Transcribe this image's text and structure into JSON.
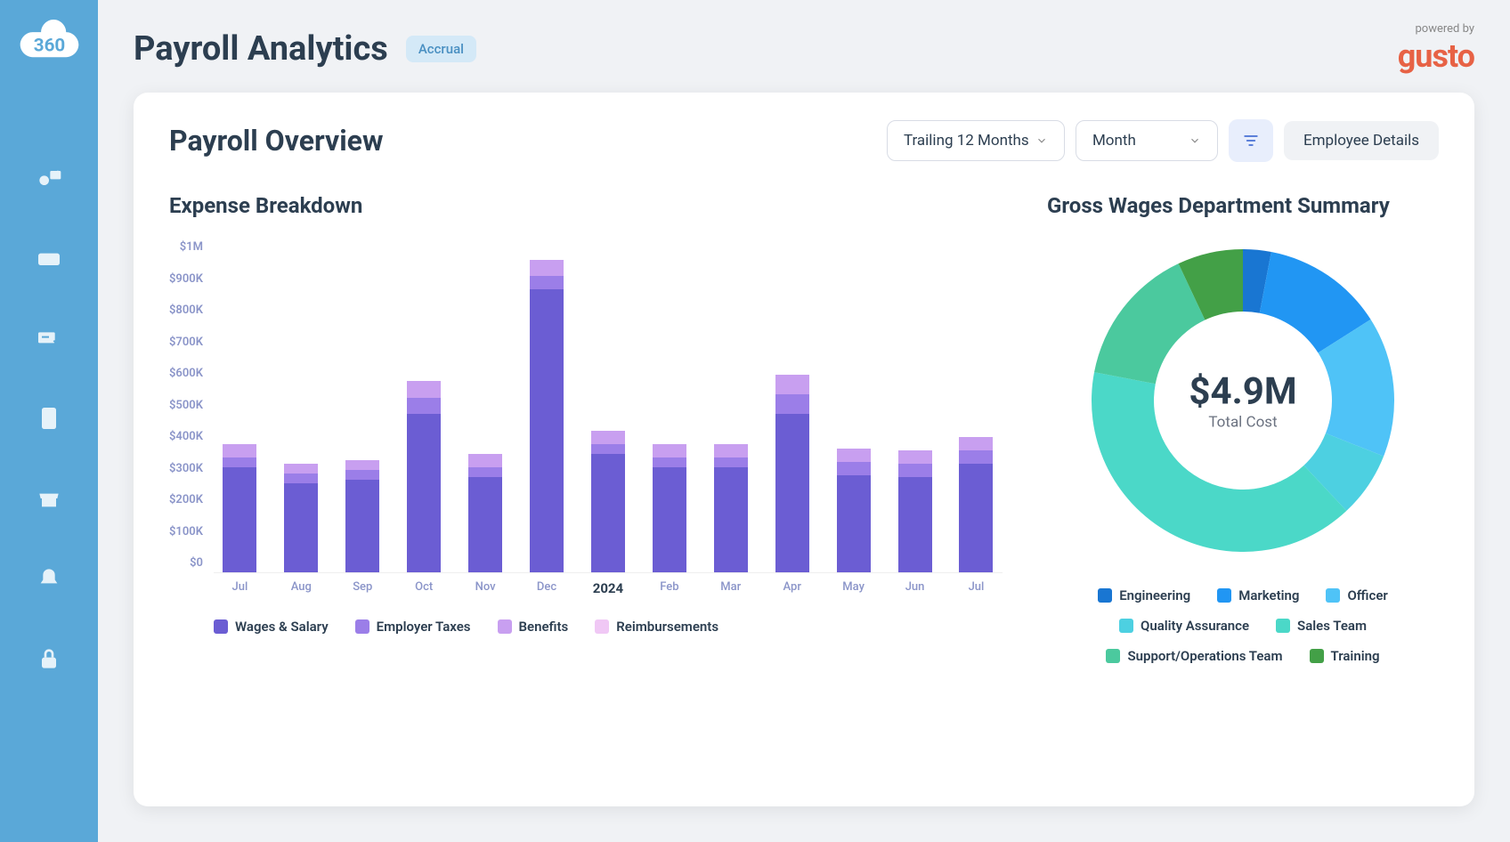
{
  "header": {
    "title": "Payroll Analytics",
    "badge": "Accrual",
    "powered_by": "powered by",
    "brand": "gusto"
  },
  "overview": {
    "title": "Payroll Overview",
    "period_select": "Trailing 12 Months",
    "granularity_select": "Month",
    "employee_details_label": "Employee Details"
  },
  "expense_chart": {
    "title": "Expense Breakdown",
    "legend": {
      "wages": "Wages & Salary",
      "taxes": "Employer Taxes",
      "benefits": "Benefits",
      "reimb": "Reimbursements"
    }
  },
  "donut": {
    "title": "Gross Wages Department Summary",
    "center_value": "$4.9M",
    "center_label": "Total Cost",
    "legend": {
      "engineering": "Engineering",
      "marketing": "Marketing",
      "officer": "Officer",
      "qa": "Quality Assurance",
      "sales": "Sales Team",
      "support": "Support/Operations Team",
      "training": "Training"
    }
  },
  "colors": {
    "wages": "#6b5dd3",
    "taxes": "#9b7ee8",
    "benefits": "#c89ff0",
    "reimb": "#f0c8f5",
    "engineering": "#1976d2",
    "marketing": "#2196f3",
    "officer": "#4fc3f7",
    "qa": "#4dd0e1",
    "sales": "#4bd8c8",
    "support": "#4bc99e",
    "training": "#43a047"
  },
  "chart_data": [
    {
      "type": "bar",
      "title": "Expense Breakdown",
      "ylabel": "",
      "xlabel": "",
      "ylim": [
        0,
        1000000
      ],
      "y_ticks": [
        "$1M",
        "$900K",
        "$800K",
        "$700K",
        "$600K",
        "$500K",
        "$400K",
        "$300K",
        "$200K",
        "$100K",
        "$0"
      ],
      "categories": [
        "Jul",
        "Aug",
        "Sep",
        "Oct",
        "Nov",
        "Dec",
        "2024",
        "Feb",
        "Mar",
        "Apr",
        "May",
        "Jun",
        "Jul"
      ],
      "series": [
        {
          "name": "Wages & Salary",
          "values": [
            320000,
            270000,
            280000,
            480000,
            290000,
            860000,
            360000,
            320000,
            320000,
            480000,
            295000,
            290000,
            330000
          ]
        },
        {
          "name": "Employer Taxes",
          "values": [
            30000,
            30000,
            30000,
            50000,
            30000,
            40000,
            30000,
            30000,
            30000,
            60000,
            40000,
            40000,
            40000
          ]
        },
        {
          "name": "Benefits",
          "values": [
            40000,
            30000,
            30000,
            50000,
            40000,
            50000,
            40000,
            40000,
            40000,
            60000,
            40000,
            40000,
            40000
          ]
        },
        {
          "name": "Reimbursements",
          "values": [
            0,
            0,
            0,
            0,
            0,
            0,
            0,
            0,
            0,
            0,
            0,
            0,
            0
          ]
        }
      ]
    },
    {
      "type": "pie",
      "title": "Gross Wages Department Summary",
      "center_value": "$4.9M",
      "center_label": "Total Cost",
      "series": [
        {
          "name": "Engineering",
          "value": 3,
          "color": "#1976d2"
        },
        {
          "name": "Marketing",
          "value": 13,
          "color": "#2196f3"
        },
        {
          "name": "Officer",
          "value": 15,
          "color": "#4fc3f7"
        },
        {
          "name": "Quality Assurance",
          "value": 7,
          "color": "#4dd0e1"
        },
        {
          "name": "Sales Team",
          "value": 40,
          "color": "#4bd8c8"
        },
        {
          "name": "Support/Operations Team",
          "value": 15,
          "color": "#4bc99e"
        },
        {
          "name": "Training",
          "value": 7,
          "color": "#43a047"
        }
      ]
    }
  ]
}
